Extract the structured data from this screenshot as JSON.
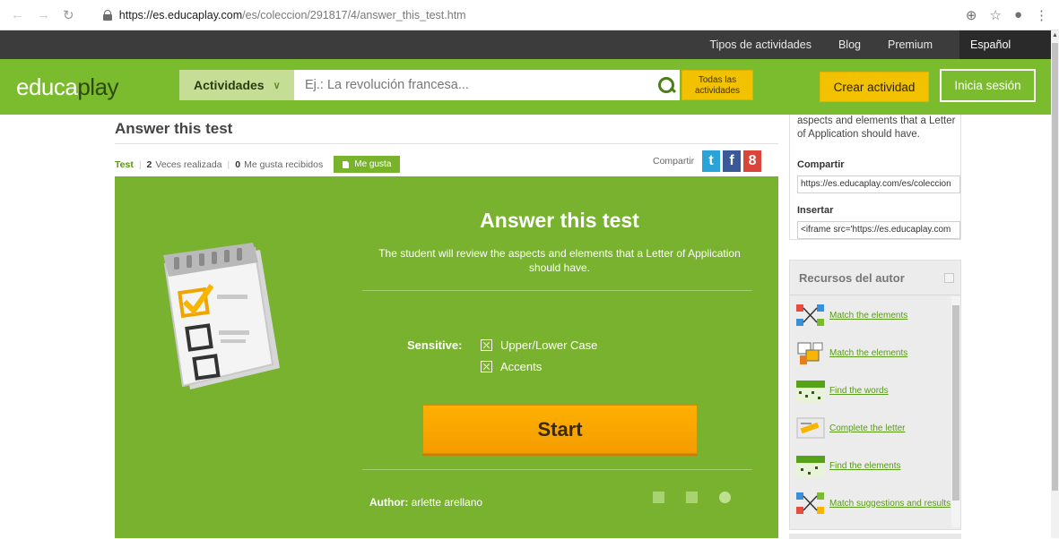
{
  "browser": {
    "url_host": "https://es.educaplay.com",
    "url_path": "/es/coleccion/291817/4/answer_this_test.htm"
  },
  "topbar": {
    "links": [
      "Tipos de actividades",
      "Blog",
      "Premium"
    ],
    "language": "Español"
  },
  "header": {
    "logo_a": "educa",
    "logo_b": "play",
    "category": "Actividades",
    "search_placeholder": "Ej.: La revolución francesa...",
    "all_activities": "Todas las actividades",
    "create": "Crear actividad",
    "login": "Inicia sesión"
  },
  "activity": {
    "title": "Answer this test",
    "type": "Test",
    "times_done": "2",
    "times_done_label": "Veces realizada",
    "likes": "0",
    "likes_label": "Me gusta recibidos",
    "like_button": "Me gusta",
    "share_label": "Compartir",
    "card_title": "Answer this test",
    "description": "The student will review the aspects and elements that a Letter of Application should have.",
    "sensitive_label": "Sensitive:",
    "options": [
      "Upper/Lower Case",
      "Accents"
    ],
    "start": "Start",
    "author_label": "Author:",
    "author_name": "arlette arellano"
  },
  "sidebar": {
    "desc_tail": "aspects and elements that a Letter of Application should have.",
    "share_label": "Compartir",
    "share_value": "https://es.educaplay.com/es/coleccion",
    "embed_label": "Insertar",
    "embed_value": "<iframe src='https://es.educaplay.com",
    "resources_title": "Recursos del autor",
    "resources": [
      "Match the elements",
      "Match the elements",
      "Find the words",
      "Complete the letter",
      "Find the elements",
      "Match suggestions and results"
    ]
  },
  "colors": {
    "brand_green": "#7bbb2e",
    "panel_green": "#78b22f",
    "accent_yellow": "#f2c200",
    "start_orange": "#f7a600"
  }
}
